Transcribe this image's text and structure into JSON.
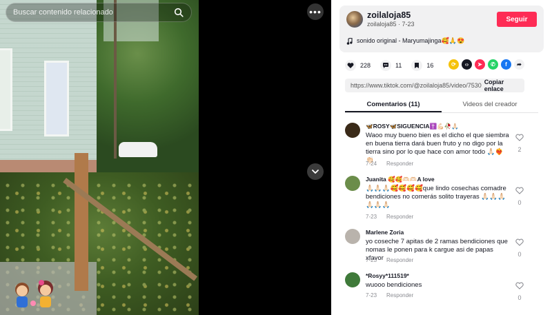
{
  "search": {
    "placeholder": "Buscar contenido relacionado"
  },
  "video": {
    "more_label": "•••"
  },
  "creator": {
    "name": "zoilaloja85",
    "sub": "zoilaloja85 · 7-23",
    "follow_label": "Seguir",
    "music": "sonido original - Maryumajinga🥰🙏😍"
  },
  "actions": {
    "likes": "228",
    "comments": "11",
    "saves": "16"
  },
  "link": {
    "url": "https://www.tiktok.com/@zoilaloja85/video/7530...",
    "copy_label": "Copiar enlace"
  },
  "tabs": [
    {
      "label": "Comentarios (11)"
    },
    {
      "label": "Videos del creador"
    }
  ],
  "comments": [
    {
      "user": "🦋ROSY🦋SIGUENCIA✝️💪🏻🥀🙏🏻",
      "text": "Waoo muy bueno bien es el dicho el que siembra en buena tierra dará buen fruto y no digo por la tierra sino por lo que hace con amor todo 🙏🏻❤️‍🔥👏🏻",
      "date": "7-24",
      "reply_label": "Responder",
      "likes": "2"
    },
    {
      "user": "Juanita 🥰🥰🫶🏻🫶🏻A love",
      "text": "🙏🏻🙏🏻🙏🏻🥰🥰🥰🥰que lindo cosechas comadre bendiciones no comerás solito trayeras 🙏🏻🙏🏻🙏🏻🙏🏻🙏🏻🙏🏻",
      "date": "7-23",
      "reply_label": "Responder",
      "likes": "0"
    },
    {
      "user": "Marlene Zoria",
      "text": "yo coseche 7 apitas de 2 ramas bendiciones que nomas le ponen para k cargue asi de papas xfavor",
      "date": "7-23",
      "reply_label": "Responder",
      "likes": "0"
    },
    {
      "user": "*Rosyy*111519*",
      "text": "wuooo bendiciones",
      "date": "7-23",
      "reply_label": "Responder",
      "likes": "0"
    }
  ],
  "colors": {
    "accent": "#fe2c55",
    "text": "#161823",
    "muted": "#8a8b91"
  }
}
